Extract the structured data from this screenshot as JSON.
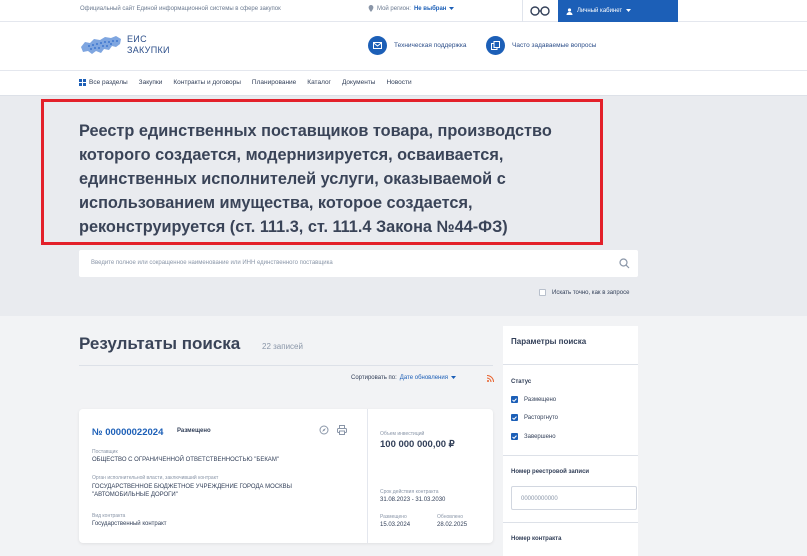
{
  "topbar": {
    "official": "Официальный сайт Единой информационной системы в сфере закупок",
    "region_label": "Мой регион:",
    "region_value": "Не выбран",
    "cabinet": "Личный кабинет"
  },
  "header": {
    "logo_line1": "ЕИС",
    "logo_line2": "ЗАКУПКИ",
    "support": "Техническая поддержка",
    "faq": "Часто задаваемые вопросы"
  },
  "nav": {
    "items": [
      "Все разделы",
      "Закупки",
      "Контракты и договоры",
      "Планирование",
      "Каталог",
      "Документы",
      "Новости"
    ]
  },
  "hero": {
    "title": "Реестр единственных поставщиков товара, производство которого создается, модернизируется, осваивается, единственных исполнителей услуги, оказываемой с использованием имущества, которое создается, реконструируется (ст. 111.3, ст. 111.4 Закона №44-ФЗ)",
    "search_placeholder": "Введите полное или сокращенное наименование или ИНН единственного поставщика",
    "exact": "Искать точно, как в запросе"
  },
  "results": {
    "title": "Результаты поиска",
    "count": "22 записей",
    "sort_label": "Сортировать по:",
    "sort_value": "Дате обновления"
  },
  "card": {
    "number": "№ 00000022024",
    "status": "Размещено",
    "supplier_label": "Поставщик",
    "supplier": "ОБЩЕСТВО С ОГРАНИЧЕННОЙ ОТВЕТСТВЕННОСТЬЮ \"БЕКАМ\"",
    "org_label": "Орган исполнительной власти, заключивший контракт",
    "org_line1": "ГОСУДАРСТВЕННОЕ БЮДЖЕТНОЕ УЧРЕЖДЕНИЕ ГОРОДА МОСКВЫ",
    "org_line2": "\"АВТОМОБИЛЬНЫЕ ДОРОГИ\"",
    "type_label": "Вид контракта",
    "type": "Государственный контракт",
    "invest_label": "Объем инвестиций",
    "amount": "100 000 000,00 ₽",
    "term_label": "Срок действия контракта",
    "term": "31.08.2023 - 31.03.2030",
    "placed_label": "Размещено",
    "placed": "15.03.2024",
    "updated_label": "Обновлено",
    "updated": "28.02.2025"
  },
  "sidebar": {
    "title": "Параметры поиска",
    "status_label": "Статус",
    "statuses": [
      "Размещено",
      "Расторгнуто",
      "Завершено"
    ],
    "reg_label": "Номер реестровой записи",
    "reg_placeholder": "00000000000",
    "contract_label": "Номер контракта"
  },
  "colors": {
    "brand": "#1c5fb7",
    "highlight": "#e3202a"
  }
}
